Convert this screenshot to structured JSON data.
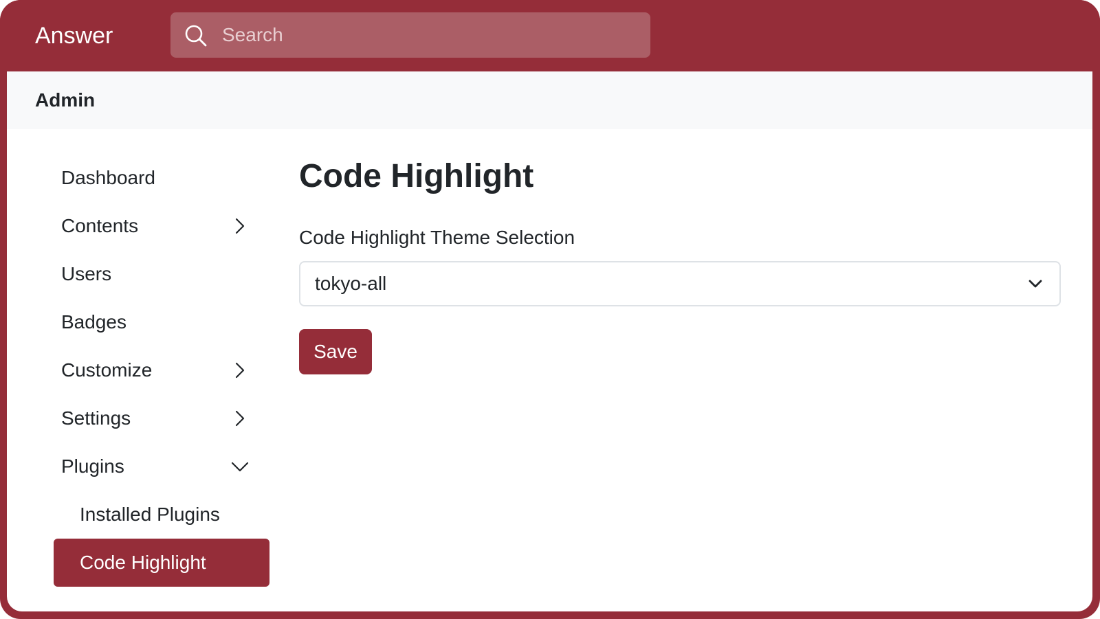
{
  "header": {
    "brand": "Answer",
    "search_placeholder": "Search"
  },
  "subheader": {
    "title": "Admin"
  },
  "sidebar": {
    "items": [
      {
        "label": "Dashboard",
        "icon": null
      },
      {
        "label": "Contents",
        "icon": "chevron-right-icon"
      },
      {
        "label": "Users",
        "icon": null
      },
      {
        "label": "Badges",
        "icon": null
      },
      {
        "label": "Customize",
        "icon": "chevron-right-icon"
      },
      {
        "label": "Settings",
        "icon": "chevron-right-icon"
      },
      {
        "label": "Plugins",
        "icon": "chevron-down-icon",
        "expanded": true
      },
      {
        "label": "Installed Plugins",
        "icon": null,
        "sub": true
      },
      {
        "label": "Code Highlight",
        "icon": null,
        "sub": true,
        "active": true
      }
    ]
  },
  "main": {
    "title": "Code Highlight",
    "field_label": "Code Highlight Theme Selection",
    "select_value": "tokyo-all",
    "save_label": "Save"
  },
  "colors": {
    "brand": "#952d39",
    "search_bg": "#ab5e66",
    "subheader_bg": "#f8f9fa",
    "text": "#212529"
  }
}
